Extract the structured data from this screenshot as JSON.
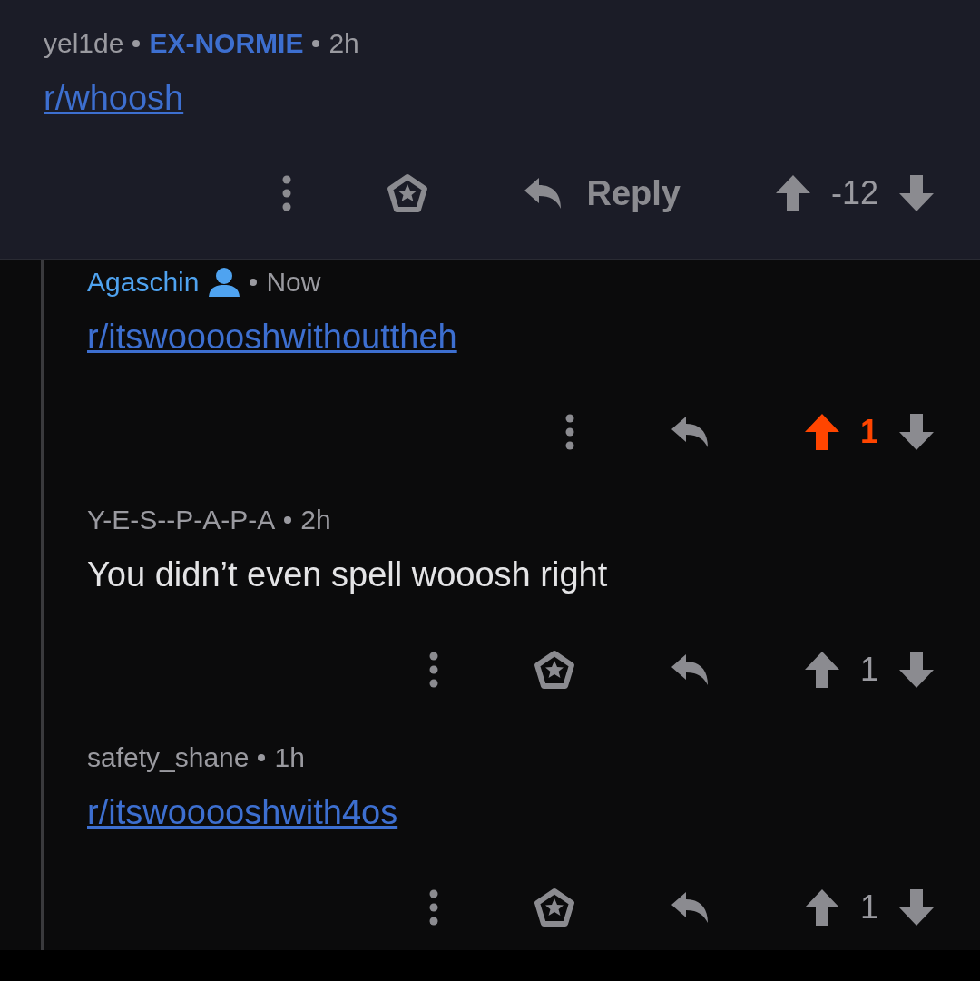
{
  "comments": [
    {
      "author": "yel1de",
      "is_self": false,
      "flair": "EX-NORMIE",
      "time": "2h",
      "body": "r/whoosh",
      "kind": "link",
      "highlighted": true,
      "nested": false,
      "has_award": true,
      "reply_label": "Reply",
      "upvoted": false,
      "score": "-12"
    },
    {
      "author": "Agaschin",
      "is_self": true,
      "time": "Now",
      "body": "r/itswooooshwithouttheh",
      "kind": "link",
      "highlighted": false,
      "nested": true,
      "has_award": false,
      "upvoted": true,
      "score": "1"
    },
    {
      "author": "Y-E-S--P-A-P-A",
      "is_self": false,
      "time": "2h",
      "body": "You didn’t even spell wooosh right",
      "kind": "text",
      "highlighted": false,
      "nested": true,
      "has_award": true,
      "upvoted": false,
      "score": "1"
    },
    {
      "author": "safety_shane",
      "is_self": false,
      "time": "1h",
      "body": "r/itswooooshwith4os",
      "kind": "link",
      "highlighted": false,
      "nested": true,
      "has_award": true,
      "upvoted": false,
      "score": "1"
    }
  ]
}
